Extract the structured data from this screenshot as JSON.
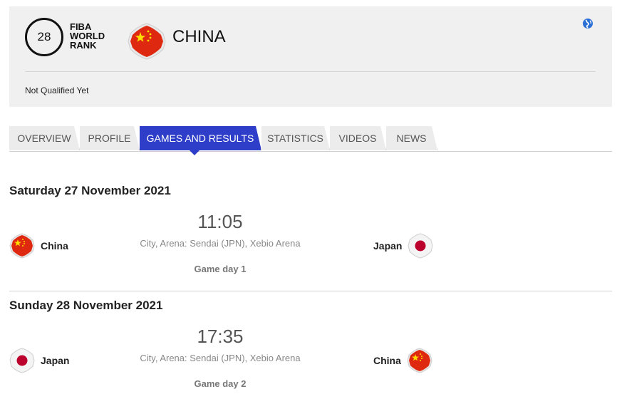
{
  "header": {
    "rank": "28",
    "rank_label": [
      "FIBA",
      "WORLD",
      "RANK"
    ],
    "country": "CHINA",
    "qualification_status": "Not Qualified Yet",
    "flag_icon": "china-flag-icon",
    "globe_icon": "globe-icon"
  },
  "tabs": [
    {
      "label": "OVERVIEW",
      "active": false
    },
    {
      "label": "PROFILE",
      "active": false
    },
    {
      "label": "GAMES AND RESULTS",
      "active": true
    },
    {
      "label": "STATISTICS",
      "active": false
    },
    {
      "label": "VIDEOS",
      "active": false
    },
    {
      "label": "NEWS",
      "active": false
    }
  ],
  "games": [
    {
      "date": "Saturday 27 November 2021",
      "home": "China",
      "away": "Japan",
      "time": "11:05",
      "venue": "City, Arena: Sendai (JPN), Xebio Arena",
      "game_day": "Game day 1"
    },
    {
      "date": "Sunday 28 November 2021",
      "home": "Japan",
      "away": "China",
      "time": "17:35",
      "venue": "City, Arena: Sendai (JPN), Xebio Arena",
      "game_day": "Game day 2"
    }
  ],
  "colors": {
    "active_tab": "#2f3ec9",
    "china_red": "#de2910",
    "china_star": "#ffde00",
    "japan_red": "#bc002d"
  }
}
